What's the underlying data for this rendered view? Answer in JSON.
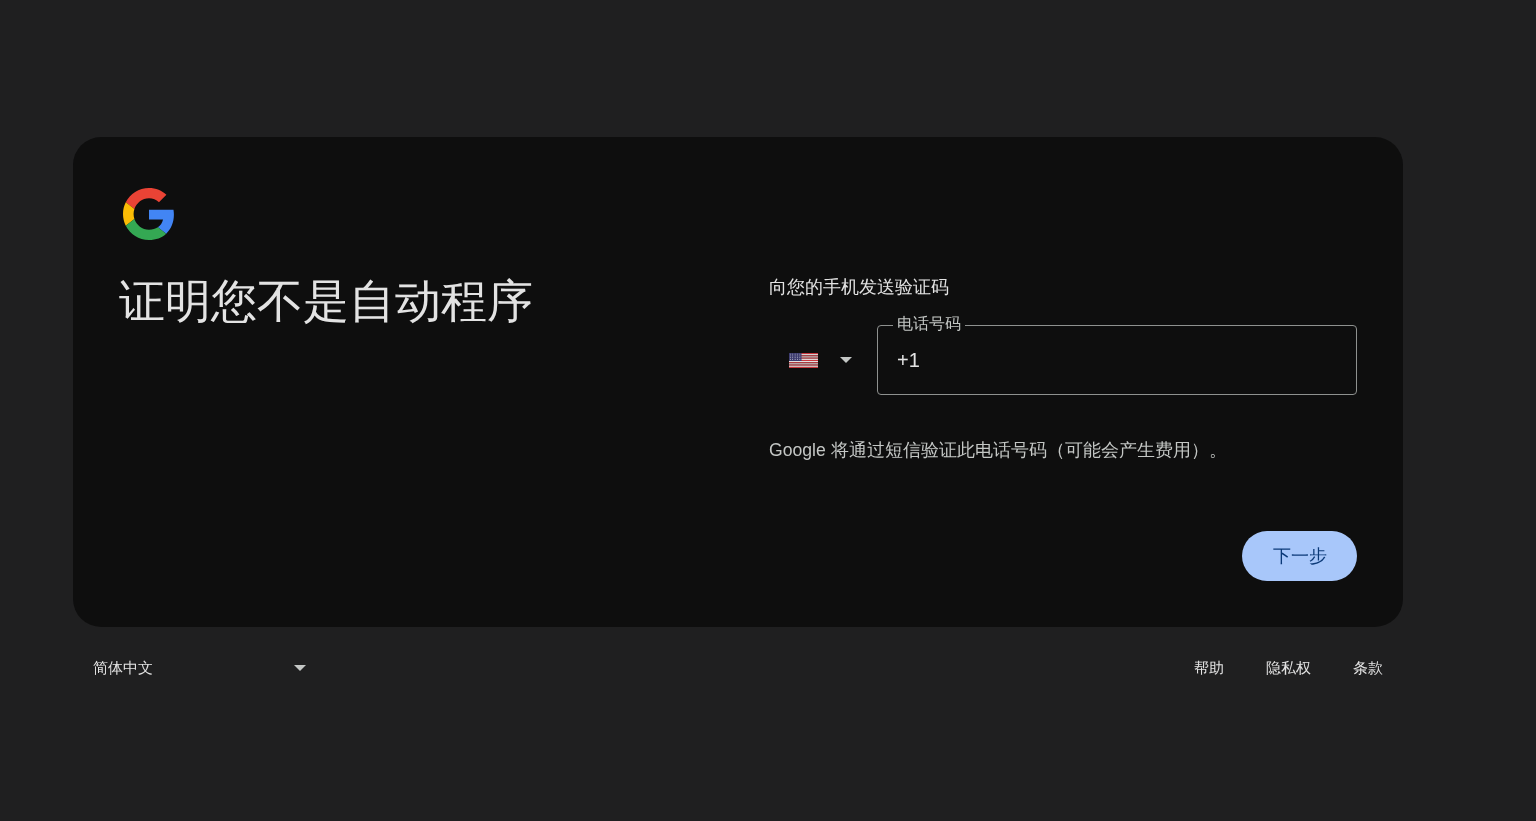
{
  "heading": "证明您不是自动程序",
  "phone_section": {
    "prompt": "向您的手机发送验证码",
    "phone_field": {
      "label": "电话号码",
      "value": "+1"
    },
    "note": "Google 将通过短信验证此电话号码（可能会产生费用）。"
  },
  "next_button": {
    "label": "下一步"
  },
  "footer": {
    "language_selector": {
      "value": "简体中文"
    },
    "links": [
      {
        "label": "帮助"
      },
      {
        "label": "隐私权"
      },
      {
        "label": "条款"
      }
    ]
  }
}
